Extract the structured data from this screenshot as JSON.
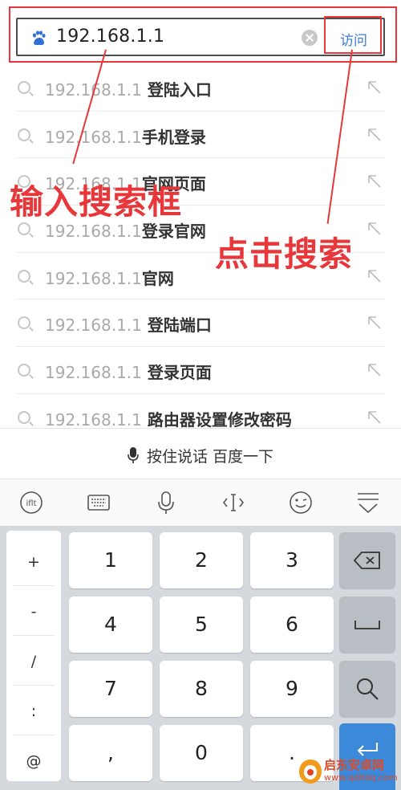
{
  "search": {
    "query": "192.168.1.1",
    "visit_label": "访问"
  },
  "suggestions": [
    {
      "prefix": "192.168.1.1",
      "suffix": " 登陆入口"
    },
    {
      "prefix": "192.168.1.1",
      "suffix": "手机登录"
    },
    {
      "prefix": "192.168.1.1",
      "suffix": "官网页面"
    },
    {
      "prefix": "192.168.1.1",
      "suffix": "登录官网"
    },
    {
      "prefix": "192.168.1.1",
      "suffix": "官网"
    },
    {
      "prefix": "192.168.1.1",
      "suffix": " 登陆端口"
    },
    {
      "prefix": "192.168.1.1",
      "suffix": " 登录页面"
    },
    {
      "prefix": "192.168.1.1",
      "suffix": " 路由器设置修改密码"
    }
  ],
  "voice_bar": {
    "label": "按住说话 百度一下"
  },
  "toolbar": {
    "icons": [
      "handwriting-icon",
      "keyboard-icon",
      "microphone-icon",
      "cursor-icon",
      "emoji-icon",
      "collapse-keyboard-icon"
    ],
    "handwriting_label": "iflt"
  },
  "keyboard": {
    "symbols": [
      "+",
      "-",
      "/",
      ":",
      "@"
    ],
    "rows": [
      [
        "1",
        "2",
        "3"
      ],
      [
        "4",
        "5",
        "6"
      ],
      [
        "7",
        "8",
        "9"
      ],
      [
        ",",
        "0",
        "."
      ]
    ],
    "function_keys": [
      "backspace-icon",
      "space-icon",
      "search-icon",
      "enter-icon"
    ]
  },
  "annotations": {
    "input_label": "输入搜索框",
    "click_label": "点击搜索"
  },
  "watermark": {
    "name": "启东安卓网",
    "url": "www.qdltdq.com"
  },
  "colors": {
    "annotation_red": "#e8373a",
    "link_blue": "#3878d8",
    "enter_blue": "#3c88d9"
  }
}
